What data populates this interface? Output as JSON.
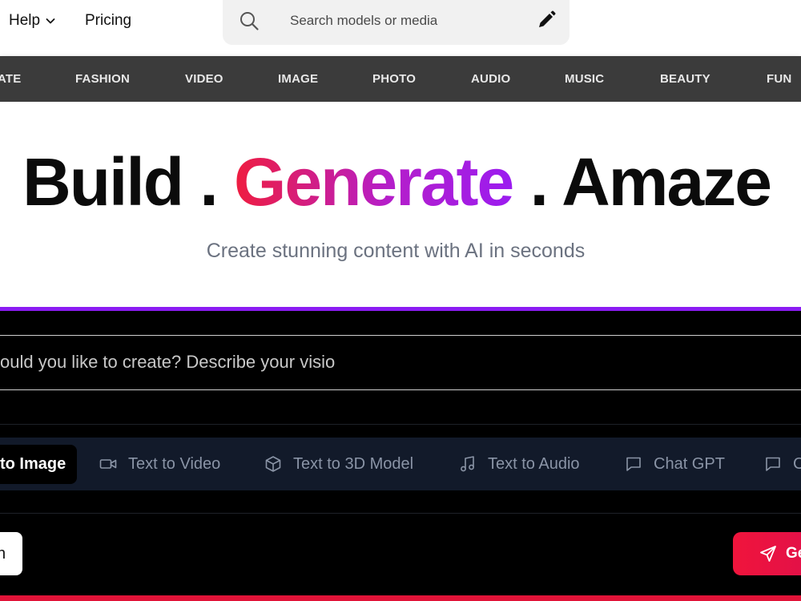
{
  "header": {
    "help_label": "Help",
    "pricing_label": "Pricing",
    "search_placeholder": "Search models or media",
    "search_icon": "search-icon",
    "edit_icon": "pencil-icon"
  },
  "categories": [
    "ATE",
    "FASHION",
    "VIDEO",
    "IMAGE",
    "PHOTO",
    "AUDIO",
    "MUSIC",
    "BEAUTY",
    "FUN"
  ],
  "hero": {
    "headline_part1": "Build .",
    "headline_gradient": "Generate",
    "headline_part3": ". Amaze",
    "subtitle": "Create stunning content with AI in seconds"
  },
  "prompt": {
    "placeholder": "ould you like to create? Describe your visio"
  },
  "modes": {
    "active": "to Image",
    "items": [
      {
        "label": "Text to Video",
        "icon": "video-icon"
      },
      {
        "label": "Text to 3D Model",
        "icon": "cube-icon"
      },
      {
        "label": "Text to Audio",
        "icon": "music-note-icon"
      },
      {
        "label": "Chat GPT",
        "icon": "chat-icon"
      },
      {
        "label": "C",
        "icon": "chat-icon"
      }
    ]
  },
  "actions": {
    "left_button_label": "n",
    "generate_label": "Ge"
  },
  "colors": {
    "accent_purple": "#8b1cf2",
    "accent_red": "#e11338",
    "gradient_start": "#ef1d3f",
    "gradient_end": "#9b1cf0",
    "category_bar": "#3b3b3b",
    "mode_bar": "#121a2a"
  }
}
